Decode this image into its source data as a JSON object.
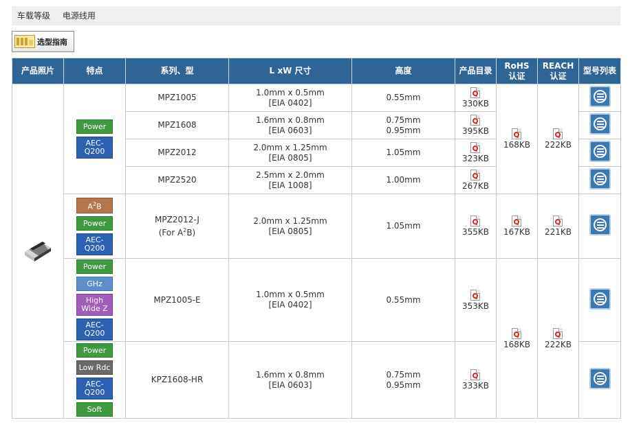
{
  "breadcrumb": [
    "车载等级",
    "电源线用"
  ],
  "guide_button": "选型指南",
  "headers": {
    "photo": "产品照片",
    "features": "特点",
    "series": "系列、型",
    "size": "L xW 尺寸",
    "height": "高度",
    "catalog": "产品目录",
    "rohs": [
      "RoHS",
      "认证"
    ],
    "reach": [
      "REACH",
      "认证"
    ],
    "list": "型号列表"
  },
  "badges": {
    "power": "Power",
    "aec": [
      "AEC-",
      "Q200"
    ],
    "a2b": "A2B",
    "ghz": "GHz",
    "highwidez": [
      "High",
      "Wide Z"
    ],
    "lowrdc": "Low Rdc",
    "soft": "Soft"
  },
  "rows": [
    {
      "series": "MPZ1005",
      "size": [
        "1.0mm x 0.5mm",
        "[EIA 0402]"
      ],
      "height": [
        "0.55mm"
      ],
      "catalog": "330KB"
    },
    {
      "series": "MPZ1608",
      "size": [
        "1.6mm x 0.8mm",
        "[EIA 0603]"
      ],
      "height": [
        "0.75mm",
        "0.95mm"
      ],
      "catalog": "395KB"
    },
    {
      "series": "MPZ2012",
      "size": [
        "2.0mm x 1.25mm",
        "[EIA 0805]"
      ],
      "height": [
        "1.05mm"
      ],
      "catalog": "323KB"
    },
    {
      "series": "MPZ2520",
      "size": [
        "2.5mm x 2.0mm",
        "[EIA 1008]"
      ],
      "height": [
        "1.00mm"
      ],
      "catalog": "267KB"
    },
    {
      "series": "MPZ2012-J",
      "series2": "(For A2B)",
      "size": [
        "2.0mm x 1.25mm",
        "[EIA 0805]"
      ],
      "height": [
        "1.05mm"
      ],
      "catalog": "355KB",
      "rohs": "167KB",
      "reach": "221KB"
    },
    {
      "series": "MPZ1005-E",
      "size": [
        "1.0mm x 0.5mm",
        "[EIA 0402]"
      ],
      "height": [
        "0.55mm"
      ],
      "catalog": "353KB"
    },
    {
      "series": "KPZ1608-HR",
      "size": [
        "1.6mm x 0.8mm",
        "[EIA 0603]"
      ],
      "height": [
        "0.75mm",
        "0.95mm"
      ],
      "catalog": "333KB"
    }
  ],
  "group1": {
    "rohs": "168KB",
    "reach": "222KB"
  },
  "group3": {
    "rohs": "168KB",
    "reach": "222KB"
  },
  "icons": {
    "photo": "chip-photo",
    "pdf": "pdf-icon",
    "list": "part-list-icon",
    "guide": "guide-icon"
  },
  "colors": {
    "header": "#2f6496",
    "power": "#3f9b3f",
    "aec": "#2a61b1",
    "a2b": "#b5764a",
    "ghz": "#5c8fca",
    "highwidez": "#a25cba",
    "lowrdc": "#6a6a6a"
  }
}
